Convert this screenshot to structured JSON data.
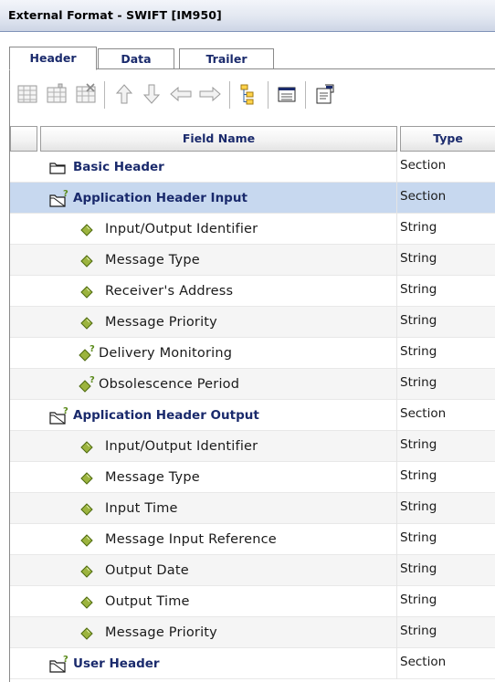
{
  "window": {
    "title": "External Format - SWIFT [IM950]"
  },
  "tabs": [
    {
      "label": "Header",
      "active": true
    },
    {
      "label": "Data",
      "active": false
    },
    {
      "label": "Trailer",
      "active": false
    }
  ],
  "toolbar": {
    "buttons": [
      {
        "icon": "add-row-icon"
      },
      {
        "icon": "insert-row-icon"
      },
      {
        "icon": "delete-row-icon"
      },
      {
        "icon": "move-up-icon"
      },
      {
        "icon": "move-down-icon"
      },
      {
        "icon": "outdent-icon"
      },
      {
        "icon": "indent-icon"
      },
      {
        "icon": "tree-view-icon"
      },
      {
        "icon": "form-view-icon"
      },
      {
        "icon": "properties-icon"
      }
    ]
  },
  "grid": {
    "columns": {
      "field_name": "Field Name",
      "type": "Type"
    },
    "rows": [
      {
        "name": "Basic Header",
        "type": "Section",
        "kind": "section",
        "optional": false,
        "selected": false
      },
      {
        "name": "Application Header Input",
        "type": "Section",
        "kind": "section",
        "optional": true,
        "selected": true
      },
      {
        "name": "Input/Output Identifier",
        "type": "String",
        "kind": "field",
        "optional": false,
        "selected": false
      },
      {
        "name": "Message Type",
        "type": "String",
        "kind": "field",
        "optional": false,
        "selected": false
      },
      {
        "name": "Receiver's Address",
        "type": "String",
        "kind": "field",
        "optional": false,
        "selected": false
      },
      {
        "name": "Message Priority",
        "type": "String",
        "kind": "field",
        "optional": false,
        "selected": false
      },
      {
        "name": "Delivery Monitoring",
        "type": "String",
        "kind": "field",
        "optional": true,
        "selected": false
      },
      {
        "name": "Obsolescence Period",
        "type": "String",
        "kind": "field",
        "optional": true,
        "selected": false
      },
      {
        "name": "Application Header Output",
        "type": "Section",
        "kind": "section",
        "optional": true,
        "selected": false
      },
      {
        "name": "Input/Output Identifier",
        "type": "String",
        "kind": "field",
        "optional": false,
        "selected": false
      },
      {
        "name": "Message Type",
        "type": "String",
        "kind": "field",
        "optional": false,
        "selected": false
      },
      {
        "name": "Input Time",
        "type": "String",
        "kind": "field",
        "optional": false,
        "selected": false
      },
      {
        "name": "Message Input Reference",
        "type": "String",
        "kind": "field",
        "optional": false,
        "selected": false
      },
      {
        "name": "Output Date",
        "type": "String",
        "kind": "field",
        "optional": false,
        "selected": false
      },
      {
        "name": "Output Time",
        "type": "String",
        "kind": "field",
        "optional": false,
        "selected": false
      },
      {
        "name": "Message Priority",
        "type": "String",
        "kind": "field",
        "optional": false,
        "selected": false
      },
      {
        "name": "User Header",
        "type": "Section",
        "kind": "section",
        "optional": true,
        "selected": false
      }
    ]
  },
  "colors": {
    "section_text": "#1a2a6c",
    "selected_row": "#c7d8ef",
    "field_diamond": "#8ea13a",
    "optional_marker": "#5a8a1a"
  }
}
